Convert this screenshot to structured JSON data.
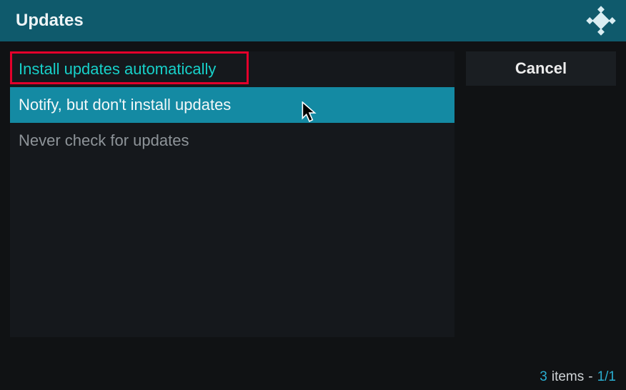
{
  "header": {
    "title": "Updates"
  },
  "options": {
    "install_auto": "Install updates automatically",
    "notify_only": "Notify, but don't install updates",
    "never_check": "Never check for updates"
  },
  "buttons": {
    "cancel": "Cancel"
  },
  "status": {
    "count": "3",
    "items_label": "items",
    "separator": "-",
    "page": "1/1"
  },
  "colors": {
    "accent": "#148aa3",
    "highlight_text": "#17d0c9",
    "header_bg": "#0f5a6c",
    "annotation_red": "#e3002b"
  }
}
